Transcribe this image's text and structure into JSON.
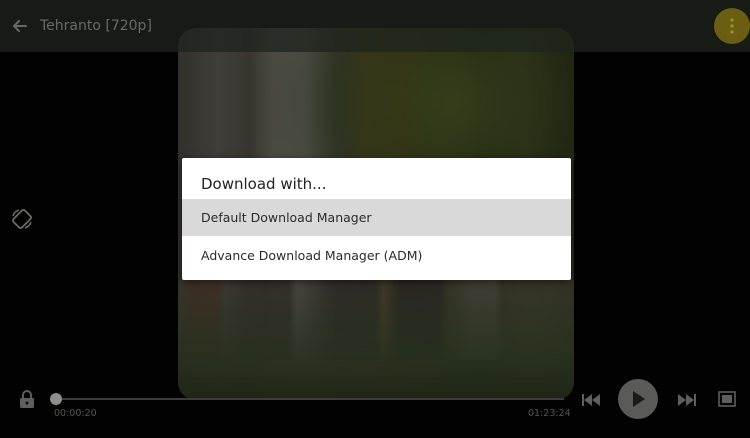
{
  "top_bar": {
    "title": "Tehranto [720p]",
    "back_icon": "arrow-left-icon",
    "more_icon": "more-vertical-icon",
    "more_button_color": "#6b5e12"
  },
  "dialog": {
    "title": "Download with...",
    "options": [
      {
        "label": "Default Download Manager",
        "selected": true
      },
      {
        "label": "Advance Download Manager (ADM)",
        "selected": false
      }
    ],
    "highlight_color": "#d9d9d9"
  },
  "player": {
    "elapsed": "00:00:20",
    "total": "01:23:24",
    "progress_fraction": 0.004,
    "icons": [
      "lock-icon",
      "rotate-icon",
      "skip-previous-icon",
      "play-icon",
      "skip-next-icon",
      "aspect-ratio-icon"
    ]
  }
}
